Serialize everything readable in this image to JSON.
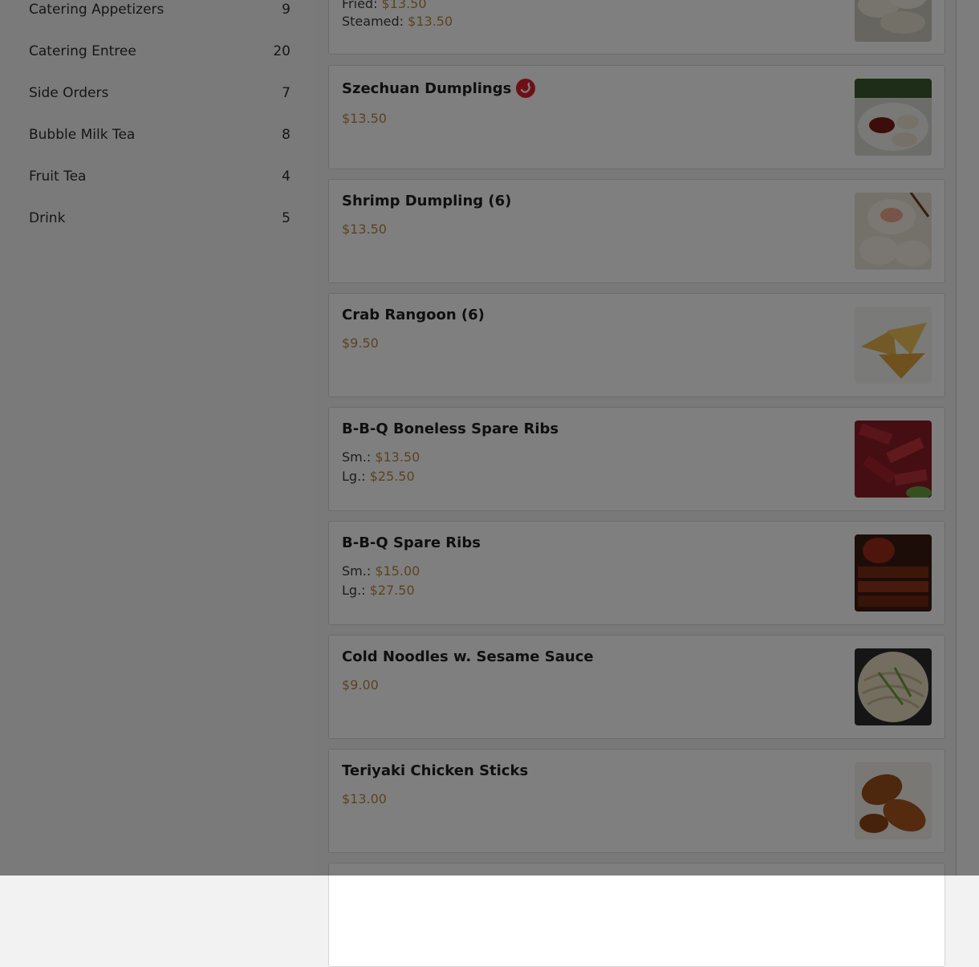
{
  "sidebar": {
    "categories": [
      {
        "label": "Catering Appetizers",
        "count": "9"
      },
      {
        "label": "Catering Entree",
        "count": "20"
      },
      {
        "label": "Side Orders",
        "count": "7"
      },
      {
        "label": "Bubble Milk Tea",
        "count": "8"
      },
      {
        "label": "Fruit Tea",
        "count": "4"
      },
      {
        "label": "Drink",
        "count": "5"
      }
    ]
  },
  "menu": {
    "items": [
      {
        "name": "",
        "lines": [
          {
            "label": "Fried:",
            "price": "$13.50"
          },
          {
            "label": "Steamed:",
            "price": "$13.50"
          }
        ],
        "icon": "dumplings-photo-icon"
      },
      {
        "name": "Szechuan Dumplings",
        "spicy": true,
        "lines": [
          {
            "label": "",
            "price": "$13.50"
          }
        ],
        "icon": "szechuan-dumplings-photo-icon"
      },
      {
        "name": "Shrimp Dumpling (6)",
        "lines": [
          {
            "label": "",
            "price": "$13.50"
          }
        ],
        "icon": "shrimp-dumpling-photo-icon"
      },
      {
        "name": "Crab Rangoon (6)",
        "lines": [
          {
            "label": "",
            "price": "$9.50"
          }
        ],
        "icon": "crab-rangoon-photo-icon"
      },
      {
        "name": "B-B-Q Boneless Spare Ribs",
        "lines": [
          {
            "label": "Sm.:",
            "price": "$13.50"
          },
          {
            "label": "Lg.:",
            "price": "$25.50"
          }
        ],
        "icon": "boneless-ribs-photo-icon"
      },
      {
        "name": "B-B-Q Spare Ribs",
        "lines": [
          {
            "label": "Sm.:",
            "price": "$15.00"
          },
          {
            "label": "Lg.:",
            "price": "$27.50"
          }
        ],
        "icon": "spare-ribs-photo-icon"
      },
      {
        "name": "Cold Noodles w. Sesame Sauce",
        "lines": [
          {
            "label": "",
            "price": "$9.00"
          }
        ],
        "icon": "cold-noodles-photo-icon"
      },
      {
        "name": "Teriyaki Chicken Sticks",
        "lines": [
          {
            "label": "",
            "price": "$13.00"
          }
        ],
        "icon": "chicken-sticks-photo-icon"
      }
    ]
  },
  "colors": {
    "price": "#b8863b",
    "spicy": "#d8202a",
    "overlay": "rgba(0,0,0,0.5)"
  }
}
